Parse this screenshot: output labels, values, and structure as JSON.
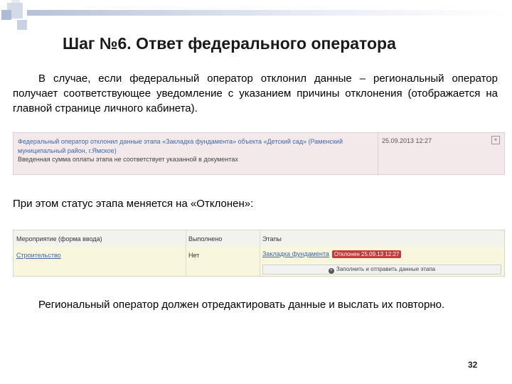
{
  "slide": {
    "title": "Шаг №6. Ответ федерального оператора",
    "paragraph1": "В случае, если федеральный оператор отклонил данные – региональный оператор получает соответствующее уведомление с указанием причины отклонения (отображается на главной странице личного кабинета).",
    "paragraph2": "При этом статус этапа меняется на «Отклонен»:",
    "paragraph3": "Региональный оператор должен отредактировать данные и выслать их повторно.",
    "page_number": "32"
  },
  "notification": {
    "message": "Федеральный оператор отклонил данные этапа «Закладка фундамента» объекта «Детский сад» (Раменский муниципальный район, г.Ямское)",
    "date": "25.09.2013 12:27",
    "reason": "Введенная сумма оплаты этапа не соответствует указанной в документах",
    "close_symbol": "×"
  },
  "stage_table": {
    "headers": [
      "Мероприятие (форма ввода)",
      "Выполнено",
      "Этапы"
    ],
    "row": {
      "activity": "Строительство",
      "done": "Нет",
      "stage": "Закладка фундамента",
      "status_badge": "Отклонен 25.09.13 12:27",
      "submit_label": "Заполнить и отправить данные этапа"
    }
  },
  "colors": {
    "link": "#3d68a8",
    "rejected_badge": "#c53b3b",
    "notification_bg": "#f4e9ea",
    "row_bg": "#f8f6dc"
  }
}
